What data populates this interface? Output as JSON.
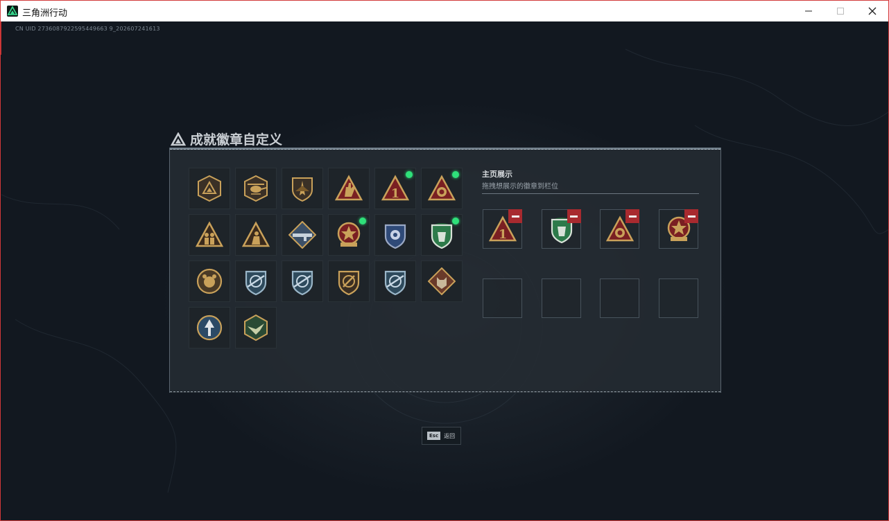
{
  "window": {
    "title": "三角洲行动",
    "controls": [
      "minimize",
      "maximize",
      "close"
    ]
  },
  "uid_text": "CN UID 2736087922595449663 9_202607241613",
  "page": {
    "title": "成就徽章自定义"
  },
  "badges": [
    {
      "icon": "delta-triangle-shield-icon",
      "new": false
    },
    {
      "icon": "helicopter-shield-icon",
      "new": false
    },
    {
      "icon": "jet-shield-icon",
      "new": false
    },
    {
      "icon": "hand-triangle-badge-icon",
      "new": false
    },
    {
      "icon": "number-one-triangle-badge-icon",
      "new": true
    },
    {
      "icon": "lion-triangle-badge-icon",
      "new": true
    },
    {
      "icon": "soldier-triangle-badge-icon",
      "new": false
    },
    {
      "icon": "soldier-kneel-triangle-badge-icon",
      "new": false
    },
    {
      "icon": "rifle-diamond-badge-icon",
      "new": false
    },
    {
      "icon": "star-medal-badge-icon",
      "new": true
    },
    {
      "icon": "police-shield-badge-icon",
      "new": false
    },
    {
      "icon": "green-beret-shield-badge-icon",
      "new": true
    },
    {
      "icon": "bear-round-badge-icon",
      "new": false
    },
    {
      "icon": "crosshair-blue-shield-badge-icon",
      "new": false
    },
    {
      "icon": "crosshair-blue-shield-badge-2-icon",
      "new": false
    },
    {
      "icon": "crosshair-bronze-shield-badge-icon",
      "new": false
    },
    {
      "icon": "crosshair-blue-shield-badge-3-icon",
      "new": false
    },
    {
      "icon": "wolf-diamond-badge-icon",
      "new": false
    },
    {
      "icon": "arrow-round-badge-icon",
      "new": false
    },
    {
      "icon": "bird-hexagon-badge-icon",
      "new": false
    }
  ],
  "showcase": {
    "title": "主页展示",
    "subtitle": "拖拽想展示的徽章到栏位",
    "slots": [
      {
        "icon": "number-one-triangle-badge-icon",
        "filled": true
      },
      {
        "icon": "green-beret-shield-badge-icon",
        "filled": true
      },
      {
        "icon": "lion-triangle-badge-icon",
        "filled": true
      },
      {
        "icon": "star-medal-badge-icon",
        "filled": true
      },
      {
        "icon": "",
        "filled": false
      },
      {
        "icon": "",
        "filled": false
      },
      {
        "icon": "",
        "filled": false
      },
      {
        "icon": "",
        "filled": false
      }
    ]
  },
  "footer": {
    "key": "Esc",
    "label": "返回"
  },
  "colors": {
    "accent_green": "#2fe07a",
    "remove_red": "#a82a2f",
    "gold": "#c9a15a"
  }
}
